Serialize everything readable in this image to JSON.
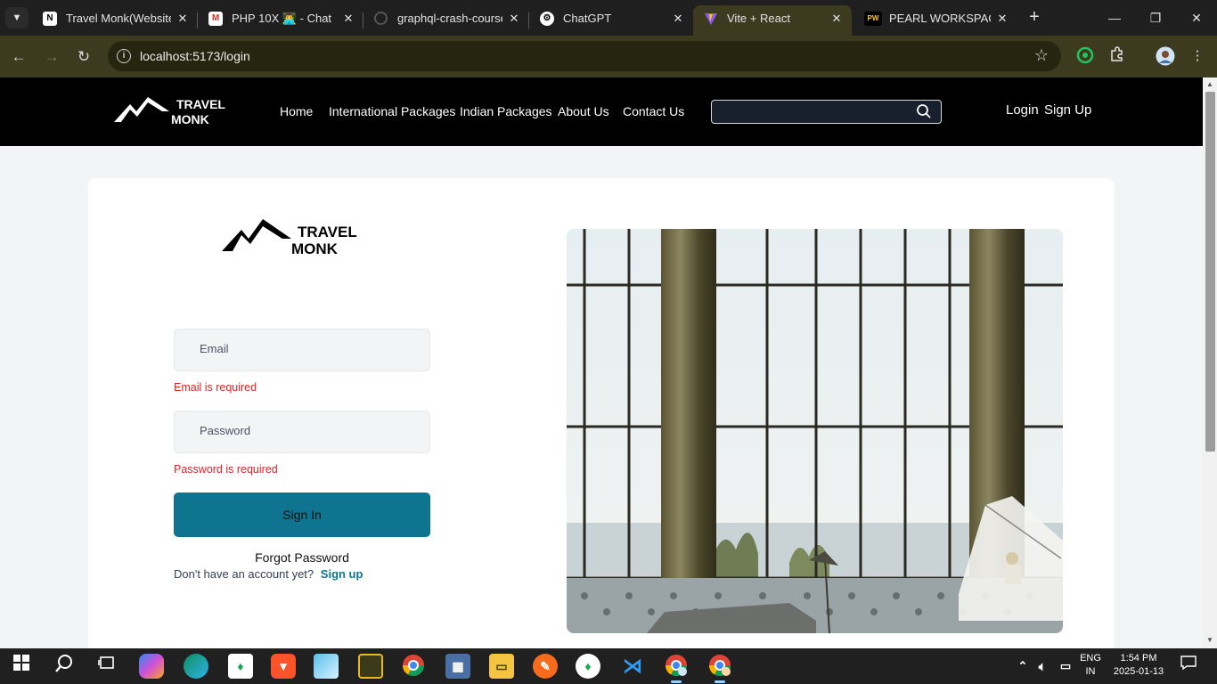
{
  "browser": {
    "tab_search_icon": "chevron-down-icon",
    "tabs": [
      {
        "title": "Travel Monk(Website",
        "favicon": "notion-icon",
        "active": false
      },
      {
        "title": "PHP 10X 👨‍💻 - Chat",
        "favicon": "gmail-icon",
        "active": false
      },
      {
        "title": "graphql-crash-course",
        "favicon": "github-icon",
        "active": false
      },
      {
        "title": "ChatGPT",
        "favicon": "chatgpt-icon",
        "active": false
      },
      {
        "title": "Vite + React",
        "favicon": "vite-icon",
        "active": true
      },
      {
        "title": "PEARL WORKSPACE |",
        "favicon": "pw-icon",
        "active": false
      }
    ],
    "url": "localhost:5173/login"
  },
  "site": {
    "logo": {
      "line1": "TRAVEL",
      "line2": "MONK"
    },
    "menu": [
      "Home",
      "International Packages",
      "Indian Packages",
      "About Us",
      "Contact Us"
    ],
    "search": {
      "placeholder": "",
      "value": ""
    },
    "auth": {
      "login": "Login",
      "signup": "Sign Up"
    }
  },
  "login": {
    "logo": {
      "line1": "TRAVEL",
      "line2": "MONK"
    },
    "email": {
      "placeholder": "Email",
      "value": "",
      "error": "Email is required"
    },
    "password": {
      "placeholder": "Password",
      "value": "",
      "error": "Password is required"
    },
    "submit": "Sign In",
    "forgot": "Forgot Password",
    "no_account": "Don't have an account yet?",
    "signup": "Sign up"
  },
  "taskbar": {
    "language": {
      "line1": "ENG",
      "line2": "IN"
    },
    "time": "1:54 PM",
    "date": "2025-01-13"
  },
  "colors": {
    "brand_primary": "#0e7490",
    "error": "#dc2626",
    "nav_background": "#000000",
    "browser_frame": "#3c3a1f"
  }
}
